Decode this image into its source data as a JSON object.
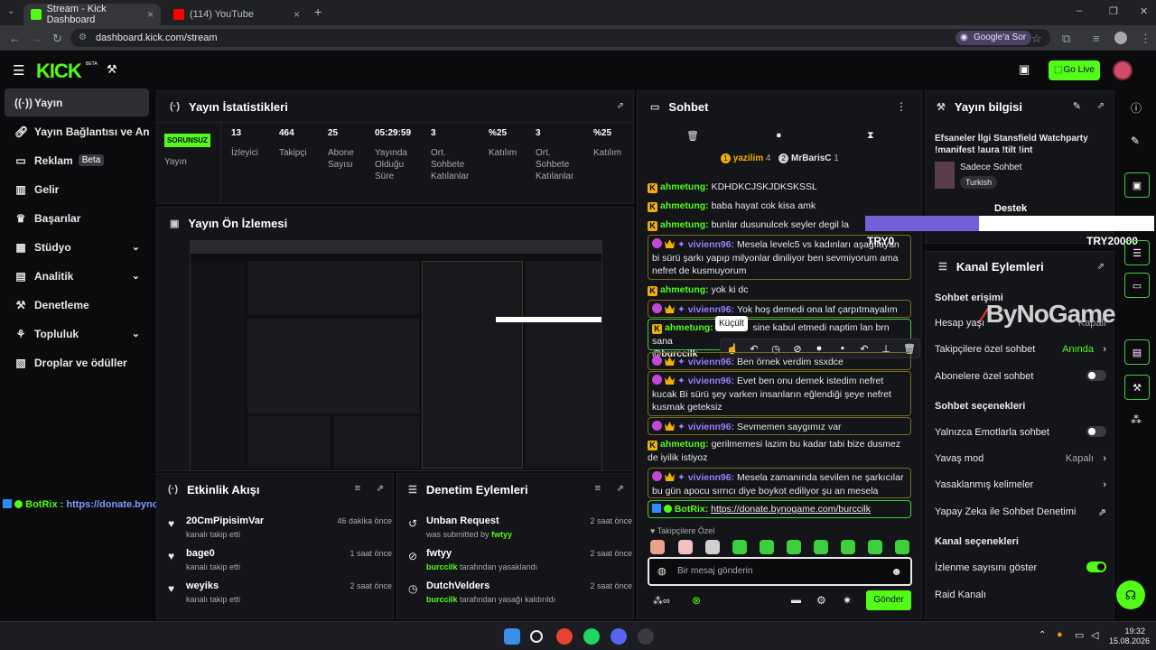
{
  "browser": {
    "tabs": [
      {
        "title": "Stream - Kick Dashboard"
      },
      {
        "title": "(114) YouTube"
      }
    ],
    "url": "dashboard.kick.com/stream",
    "google_sor": "Google'a Sor"
  },
  "topbar": {
    "logo": "KICK",
    "logo_sup": "BETA",
    "go_live": "Go Live"
  },
  "sidebar": {
    "items": [
      {
        "label": "Yayın",
        "icon": "broadcast-icon"
      },
      {
        "label": "Yayın Bağlantısı ve Anahtar",
        "icon": "link-icon"
      },
      {
        "label": "Reklam",
        "badge": "Beta",
        "icon": "ad-icon"
      },
      {
        "label": "Gelir",
        "icon": "chart-icon"
      },
      {
        "label": "Başarılar",
        "icon": "trophy-icon"
      },
      {
        "label": "Stüdyo",
        "icon": "studio-icon"
      },
      {
        "label": "Analitik",
        "icon": "analytics-icon"
      },
      {
        "label": "Denetleme",
        "icon": "hammer-icon"
      },
      {
        "label": "Topluluk",
        "icon": "community-icon"
      },
      {
        "label": "Droplar ve ödüller",
        "icon": "gift-icon"
      }
    ]
  },
  "stats": {
    "title": "Yayın İstatistikleri",
    "status_badge": "SORUNSUZ",
    "status_label": "Yayın",
    "cells": [
      {
        "value": "13",
        "label": "İzleyici"
      },
      {
        "value": "464",
        "label": "Takipçi"
      },
      {
        "value": "25",
        "label": "Abone Sayısı"
      },
      {
        "value": "05:29:59",
        "label": "Yayında Olduğu Süre"
      },
      {
        "value": "3",
        "label": "Ort. Sohbete Katılanlar"
      },
      {
        "value": "%25",
        "label": "Katılım"
      },
      {
        "value": "3",
        "label": "Ort. Sohbete Katılanlar"
      },
      {
        "value": "%25",
        "label": "Katılım"
      }
    ]
  },
  "preview": {
    "title": "Yayın Ön İzlemesi"
  },
  "overlay": {
    "botrix_label": "BotRix :",
    "botrix_link": "https://donate.bynogame.com/burccilk",
    "goal_left": "TRY0",
    "goal_right": "TRY20000",
    "destek": "Destek",
    "bynogame": "ByNoGame"
  },
  "activity": {
    "title": "Etkinlik Akışı",
    "items": [
      {
        "name": "20CmPipisimVar",
        "sub": "kanalı takip etti",
        "time": "46 dakika önce"
      },
      {
        "name": "bage0",
        "sub": "kanalı takip etti",
        "time": "1 saat önce"
      },
      {
        "name": "weyiks",
        "sub": "kanalı takip etti",
        "time": "2 saat önce"
      }
    ]
  },
  "moderation": {
    "title": "Denetim Eylemleri",
    "items": [
      {
        "name": "Unban Request",
        "sub_prefix": "was submitted by ",
        "sub_user": "fwtyy",
        "time": "2 saat önce"
      },
      {
        "name": "fwtyy",
        "sub_user": "burccilk",
        "sub_suffix": " tarafından yasaklandı",
        "time": "2 saat önce"
      },
      {
        "name": "DutchVelders",
        "sub_user": "burccilk",
        "sub_suffix": " tarafından yasağı kaldırıldı",
        "time": "2 saat önce"
      }
    ]
  },
  "chat": {
    "title": "Sohbet",
    "top_users": [
      {
        "name": "yazilim",
        "count": "4"
      },
      {
        "name": "MrBarisC",
        "count": "1"
      }
    ],
    "messages": [
      {
        "user": "ahmetung",
        "text": "KDHDKCJSKJDKSKSSL"
      },
      {
        "user": "ahmetung",
        "text": "baba hayat cok kisa amk"
      },
      {
        "user": "ahmetung",
        "text": "bunlar dusunulcek seyler degil la"
      },
      {
        "user": "vivienn96",
        "text": "Mesela levelc5 vs kadınları aşağılayan bi sürü şarkı yapıp milyonlar diniliyor ben sevmiyorum ama nefret de kusmuyorum"
      },
      {
        "user": "ahmetung",
        "text": "yok ki dc"
      },
      {
        "user": "vivienn96",
        "text": "Yok hoş demedi ona laf çarpıtmayalım"
      },
      {
        "user": "ahmetung",
        "text": "b",
        "text2": "sine kabul etmedi naptim lan brn sana",
        "mention": "@burccilk"
      },
      {
        "user": "vivienn96",
        "text": "Ben örnek verdim ssxdce"
      },
      {
        "user": "vivienn96",
        "text": "Evet ben onu demek istedim nefret kucak Bi sürü şey varken insanların eğlendiği şeye nefret kusmak geteksiz"
      },
      {
        "user": "vivienn96",
        "text": "Sevmemen saygımız var"
      },
      {
        "user": "ahmetung",
        "text": "gerilmemesi lazim bu kadar tabi bize dusmez de iyilik istiyoz"
      },
      {
        "user": "vivienn96",
        "text": "Mesela zamanında sevilen ne şarkıcılar bu gün apocu sırrıcı diye boykot ediliyor şu an mesela"
      },
      {
        "user": "BotRix",
        "text": "https://donate.bynogame.com/burccilk"
      }
    ],
    "tooltip": "Küçült",
    "emote_label": "Takipçilere Özel",
    "placeholder": "Bir mesaj gönderin",
    "send": "Gönder"
  },
  "info": {
    "title": "Yayın bilgisi",
    "stream_title": "Efsaneler İlgi Stansfield Watchparty !manifest !aura !tilt !int",
    "category": "Sadece Sohbet",
    "tag": "Turkish"
  },
  "channel": {
    "title": "Kanal Eylemleri",
    "section1": "Sohbet erişimi",
    "rows1": [
      {
        "label": "Hesap yaşı",
        "value": "Kapalı"
      },
      {
        "label": "Takipçilere özel sohbet",
        "value": "Anında"
      },
      {
        "label": "Abonelere özel sohbet",
        "toggle": false
      }
    ],
    "section2": "Sohbet seçenekleri",
    "rows2": [
      {
        "label": "Yalnızca Emotlarla sohbet",
        "toggle": false
      },
      {
        "label": "Yavaş mod",
        "value": "Kapalı"
      },
      {
        "label": "Yasaklanmış kelimeler"
      },
      {
        "label": "Yapay Zeka ile Sohbet Denetimi"
      }
    ],
    "section3": "Kanal seçenekleri",
    "rows3": [
      {
        "label": "İzlenme sayısını göster",
        "toggle": true
      },
      {
        "label": "Raid Kanalı"
      }
    ]
  },
  "taskbar": {
    "time": "19:32",
    "date": "15.08.2026"
  },
  "colors": {
    "brand": "#53fc18",
    "bg": "#0b0b0e",
    "panel": "#141518",
    "mention_purple": "#9b7cff"
  }
}
